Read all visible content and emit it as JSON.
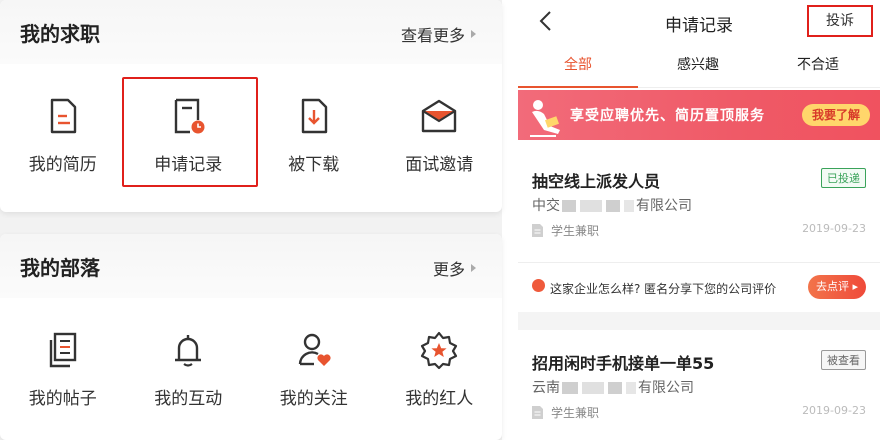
{
  "left": {
    "jobs_card": {
      "title": "我的求职",
      "more_label": "查看更多",
      "items": [
        {
          "label": "我的简历",
          "icon": "resume-icon"
        },
        {
          "label": "申请记录",
          "icon": "application-record-icon"
        },
        {
          "label": "被下载",
          "icon": "downloaded-icon"
        },
        {
          "label": "面试邀请",
          "icon": "interview-invite-icon"
        }
      ]
    },
    "tribe_card": {
      "title": "我的部落",
      "more_label": "更多",
      "items": [
        {
          "label": "我的帖子",
          "icon": "posts-icon"
        },
        {
          "label": "我的互动",
          "icon": "bell-icon"
        },
        {
          "label": "我的关注",
          "icon": "follow-icon"
        },
        {
          "label": "我的红人",
          "icon": "star-badge-icon"
        }
      ]
    }
  },
  "right": {
    "nav": {
      "title": "申请记录",
      "complaint_label": "投诉"
    },
    "tabs": [
      {
        "label": "全部",
        "active": true
      },
      {
        "label": "感兴趣",
        "active": false
      },
      {
        "label": "不合适",
        "active": false
      }
    ],
    "banner": {
      "text": "享受应聘优先、简历置顶服务",
      "button_label": "我要了解"
    },
    "jobs": [
      {
        "title": "抽空线上派发人员",
        "company_prefix": "中交",
        "company_suffix": "有限公司",
        "status": "已投递",
        "tag": "学生兼职",
        "date": "2019-09-23"
      },
      {
        "title": "招用闲时手机接单一单55",
        "company_prefix": "云南",
        "company_suffix": "有限公司",
        "status": "被查看",
        "tag": "学生兼职",
        "date": "2019-09-23"
      }
    ],
    "review": {
      "text": "这家企业怎么样? 匿名分享下您的公司评价",
      "button_label": "去点评 ▸"
    }
  },
  "colors": {
    "accent": "#e8542f",
    "highlight": "#e0201b",
    "status_green": "#3aa35a"
  }
}
